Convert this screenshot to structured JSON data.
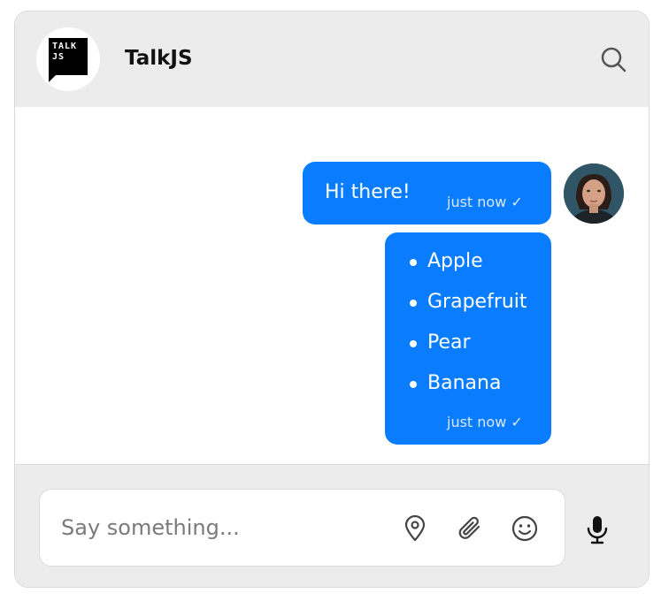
{
  "header": {
    "logo_line1": "TALK",
    "logo_line2": "JS",
    "title": "TalkJS"
  },
  "messages": [
    {
      "text": "Hi there!",
      "time": "just now ✓"
    },
    {
      "items": [
        "Apple",
        "Grapefruit",
        "Pear",
        "Banana"
      ],
      "time": "just now ✓"
    }
  ],
  "composer": {
    "placeholder": "Say something..."
  },
  "icons": {
    "search": "search-icon",
    "location": "location-pin-icon",
    "attach": "paperclip-icon",
    "emoji": "smiley-icon",
    "microphone": "microphone-icon"
  },
  "colors": {
    "bubble": "#0a7cff",
    "header_bg": "#ececec"
  }
}
